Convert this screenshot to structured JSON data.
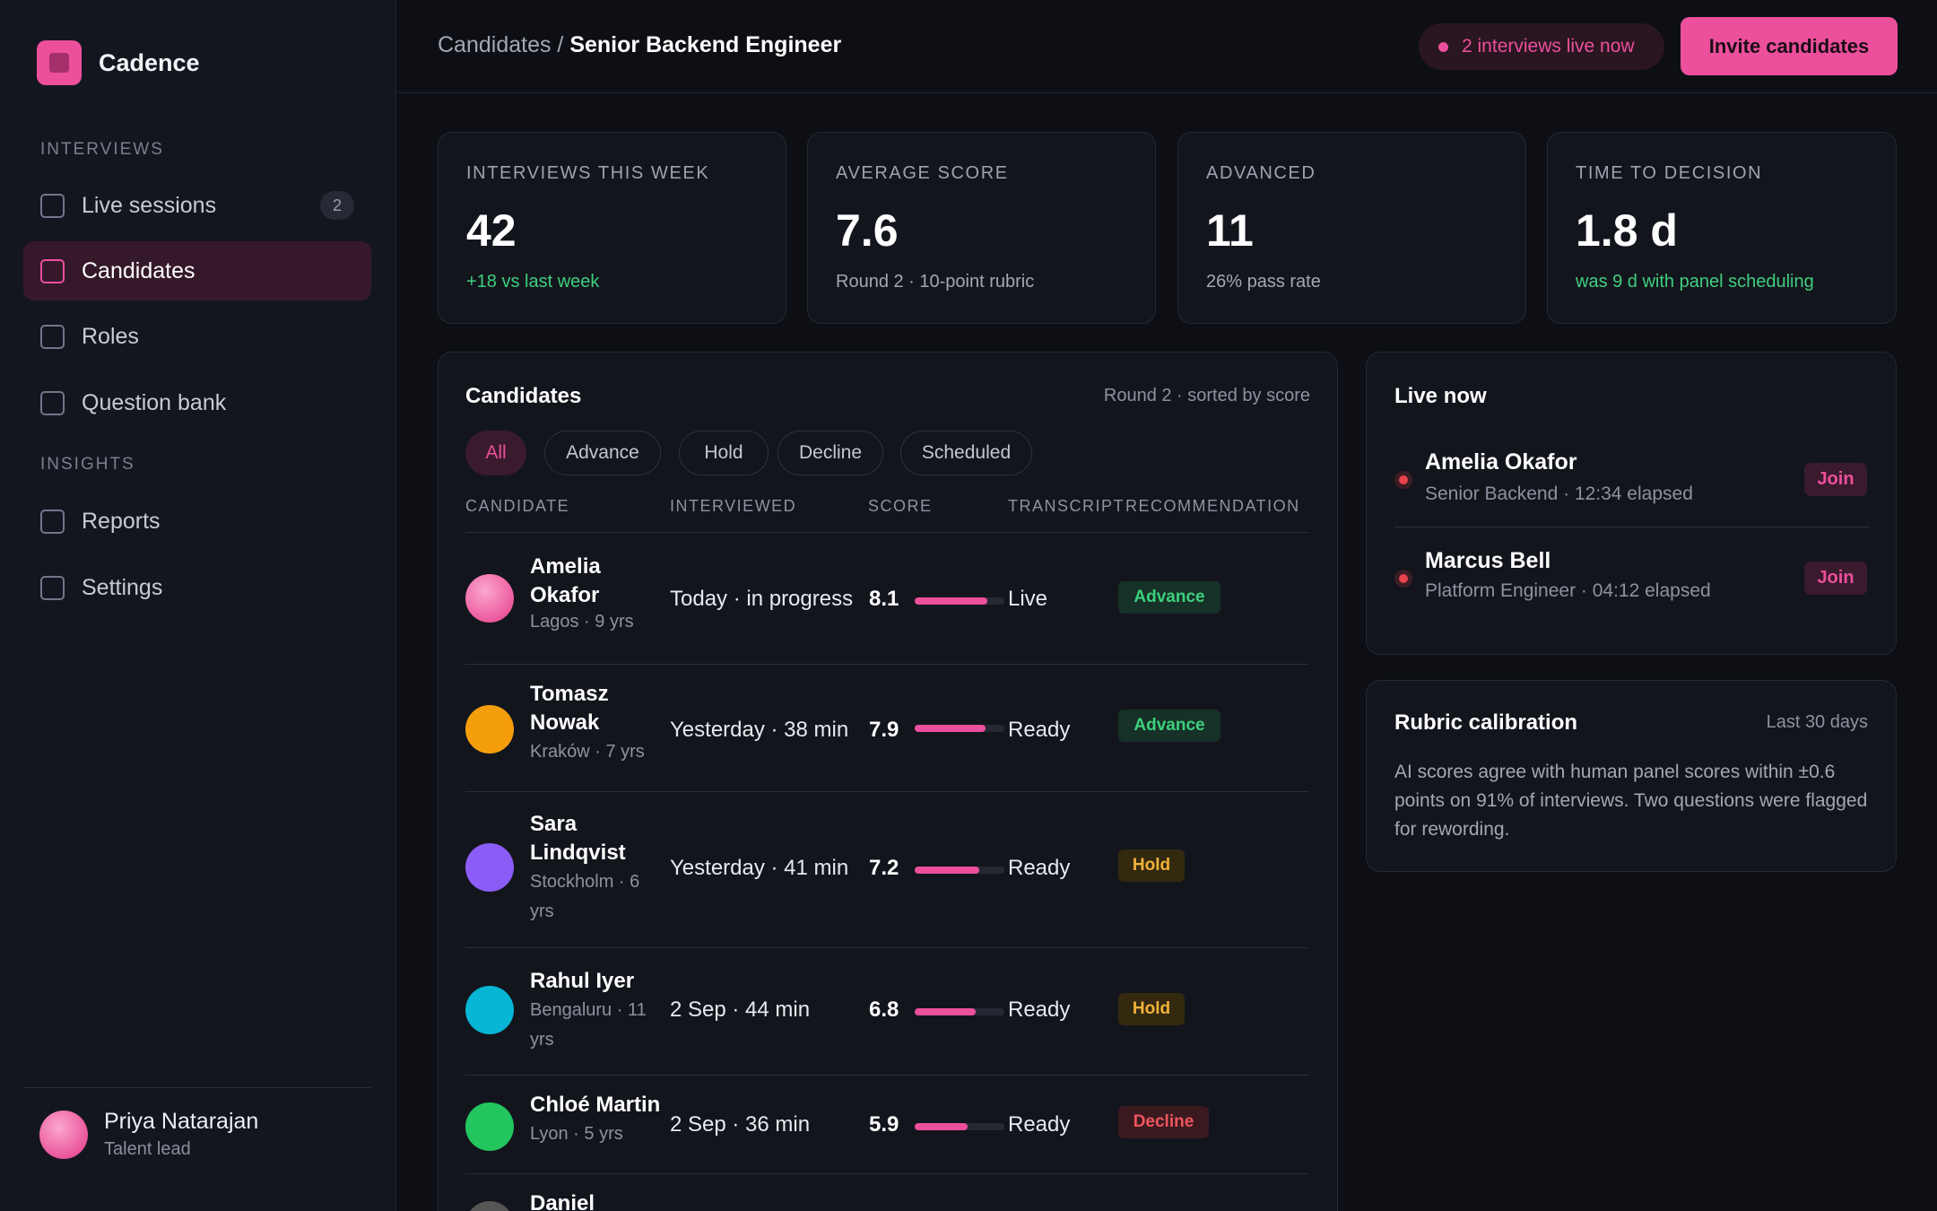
{
  "brand": {
    "name": "Cadence"
  },
  "sidebar": {
    "section_interviews": "INTERVIEWS",
    "section_insights": "INSIGHTS",
    "items": [
      {
        "label": "Live sessions",
        "count": "2"
      },
      {
        "label": "Candidates",
        "active": true
      },
      {
        "label": "Roles"
      },
      {
        "label": "Question bank"
      },
      {
        "label": "Reports"
      },
      {
        "label": "Settings"
      }
    ],
    "user": {
      "name": "Priya Natarajan",
      "role": "Talent lead"
    }
  },
  "header": {
    "crumb_parent": "Candidates",
    "crumb_sep": " / ",
    "crumb_current": "Senior Backend Engineer",
    "live_pill": "2 interviews live now",
    "invite_label": "Invite candidates"
  },
  "stats": [
    {
      "label": "INTERVIEWS THIS WEEK",
      "value": "42",
      "note": "+18 vs last week"
    },
    {
      "label": "AVERAGE SCORE",
      "value": "7.6",
      "note": "Round 2 · 10-point rubric"
    },
    {
      "label": "ADVANCED",
      "value": "11",
      "note": "26% pass rate"
    },
    {
      "label": "TIME TO DECISION",
      "value": "1.8 d",
      "note": "was 9 d with panel scheduling"
    }
  ],
  "candidates": {
    "title": "Candidates",
    "meta": "Round 2 · sorted by score",
    "filters": [
      "All",
      "Advance",
      "Hold",
      "Decline",
      "Scheduled"
    ],
    "columns": [
      "CANDIDATE",
      "INTERVIEWED",
      "SCORE",
      "TRANSCRIPT",
      "RECOMMENDATION"
    ],
    "rows": [
      {
        "name": "Amelia Okafor",
        "sub": "Lagos · 9 yrs",
        "when": "Today · in progress",
        "score": "8.1",
        "score_frac": 0.81,
        "status": "Live",
        "rec": "Advance"
      },
      {
        "name": "Tomasz Nowak",
        "sub": "Kraków · 7 yrs",
        "when": "Yesterday · 38 min",
        "score": "7.9",
        "score_frac": 0.79,
        "status": "Ready",
        "rec": "Advance"
      },
      {
        "name": "Sara Lindqvist",
        "sub": "Stockholm · 6 yrs",
        "when": "Yesterday · 41 min",
        "score": "7.2",
        "score_frac": 0.72,
        "status": "Ready",
        "rec": "Hold"
      },
      {
        "name": "Rahul Iyer",
        "sub": "Bengaluru · 11 yrs",
        "when": "2 Sep · 44 min",
        "score": "6.8",
        "score_frac": 0.68,
        "status": "Ready",
        "rec": "Hold"
      },
      {
        "name": "Chloé Martin",
        "sub": "Lyon · 5 yrs",
        "when": "2 Sep · 36 min",
        "score": "5.9",
        "score_frac": 0.59,
        "status": "Ready",
        "rec": "Decline"
      },
      {
        "name": "Daniel",
        "sub": "",
        "when": "",
        "score": "",
        "status": "",
        "rec": ""
      }
    ]
  },
  "live_now": {
    "title": "Live now",
    "join_label": "Join",
    "items": [
      {
        "name": "Amelia Okafor",
        "sub": "Senior Backend · 12:34 elapsed"
      },
      {
        "name": "Marcus Bell",
        "sub": "Platform Engineer · 04:12 elapsed"
      }
    ]
  },
  "rubric": {
    "title": "Rubric calibration",
    "meta": "Last 30 days",
    "text": "AI scores agree with human panel scores within ±0.6 points on 91% of interviews. Two questions were flagged for rewording."
  },
  "colors": {
    "accent": "#ec4f9c",
    "advance": "#3ecf7e",
    "hold": "#f2b23a",
    "decline": "#f0555f",
    "live": "#e8424e"
  },
  "avatar_colors": [
    "#ef6aa9",
    "#f59e0b",
    "#8b5cf6",
    "#06b6d4",
    "#22c55e"
  ]
}
